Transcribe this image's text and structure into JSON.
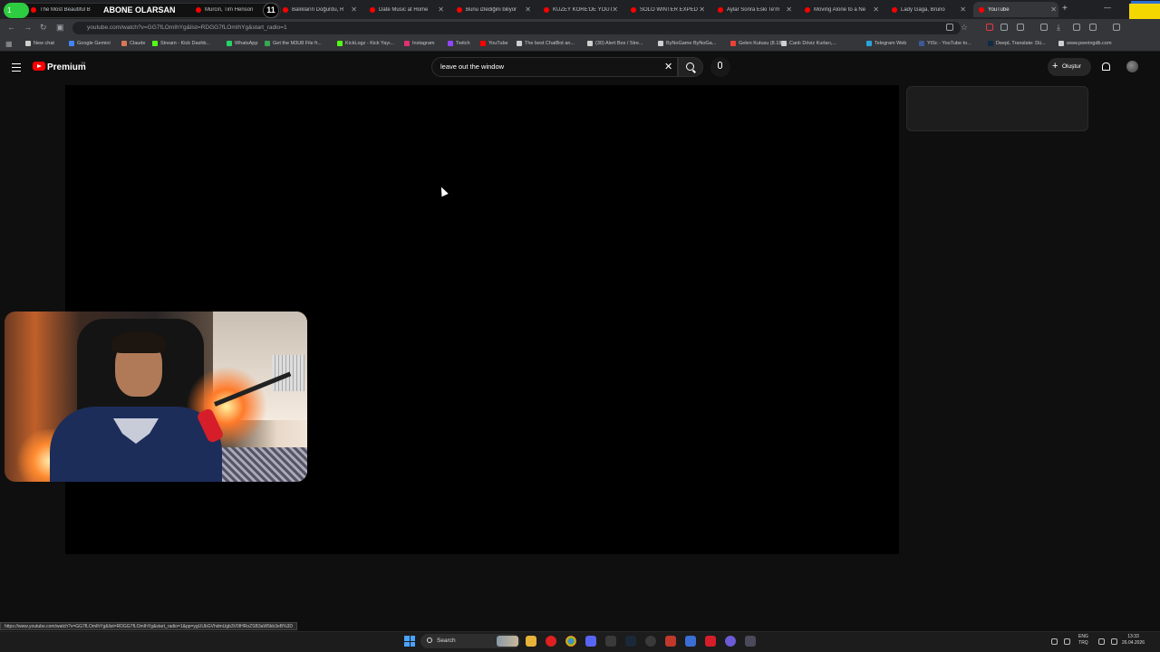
{
  "browser": {
    "overlay": {
      "green_label": "1",
      "text": "ABONE OLARSAN",
      "count": "11"
    },
    "tabs": [
      {
        "label": "The Most Beautiful B",
        "active": false
      },
      {
        "label": "Murcin, Tim Henson",
        "active": false
      },
      {
        "label": "Balıkların Doğurdu, R",
        "active": false
      },
      {
        "label": "Date Music at Home",
        "active": false
      },
      {
        "label": "Bunu izlediğini biliyor",
        "active": false
      },
      {
        "label": "KUZEY KORE'DE YOUT",
        "active": false
      },
      {
        "label": "SOLO WINTER EXPED",
        "active": false
      },
      {
        "label": "Aylar Sonra Eski Te'm",
        "active": false
      },
      {
        "label": "Moving Alone to a Ne",
        "active": false
      },
      {
        "label": "Lady Gaga, Bruno",
        "active": false
      },
      {
        "label": "YouTube",
        "active": true
      }
    ],
    "url": "youtube.com/watch?v=GG7fLOmIhYg&list=RDGG7fLOmIhYg&start_radio=1",
    "bookmarks": [
      "New chat",
      "Google Gemini",
      "Claude",
      "Stream - Kick Dashb...",
      "WhatsApp",
      "Get the M3U8 File fr...",
      "KickLogz - Kick Yayı...",
      "Instagram",
      "Twitch",
      "YouTube",
      "The best ChatBot an...",
      "(30) Alert Box / Stre...",
      "ByNoGame ByNoGa...",
      "Gelen Kutusu (8.185...",
      "Canlı Döviz Kurları,...",
      "Telegram Web",
      "YtSc - YouTube to...",
      "DeepL Translate: Dü...",
      "www.peeringdb.com"
    ],
    "bookmark_colors": [
      "#cfcfcf",
      "#4285f4",
      "#d97757",
      "#53fc18",
      "#25d366",
      "#34a853",
      "#53fc18",
      "#e1306c",
      "#9146ff",
      "#ff0000",
      "#cfcfcf",
      "#cfcfcf",
      "#cfcfcf",
      "#ea4335",
      "#cfcfcf",
      "#2aa3e0",
      "#3b5998",
      "#0f2b46",
      "#cfcfcf"
    ],
    "status_url": "https://www.youtube.com/watch?v=GG7fLOmIhYg&list=RDGG7fLOmIhYg&start_radio=1&pp=ygUUbGVhdmUgb3V0IHRoZSB3aW5kb3eB%3D"
  },
  "youtube": {
    "brand": "Premium",
    "region": "TR",
    "search": {
      "value": "leave out the window"
    },
    "create_label": "Oluştur"
  },
  "taskbar": {
    "search_label": "Search",
    "lang_line1": "ENG",
    "lang_line2": "TRQ",
    "time": "13:33",
    "date": "26.04.2026"
  },
  "colors": {
    "accent": "#ff0000",
    "page_bg": "#0f0f0f"
  }
}
